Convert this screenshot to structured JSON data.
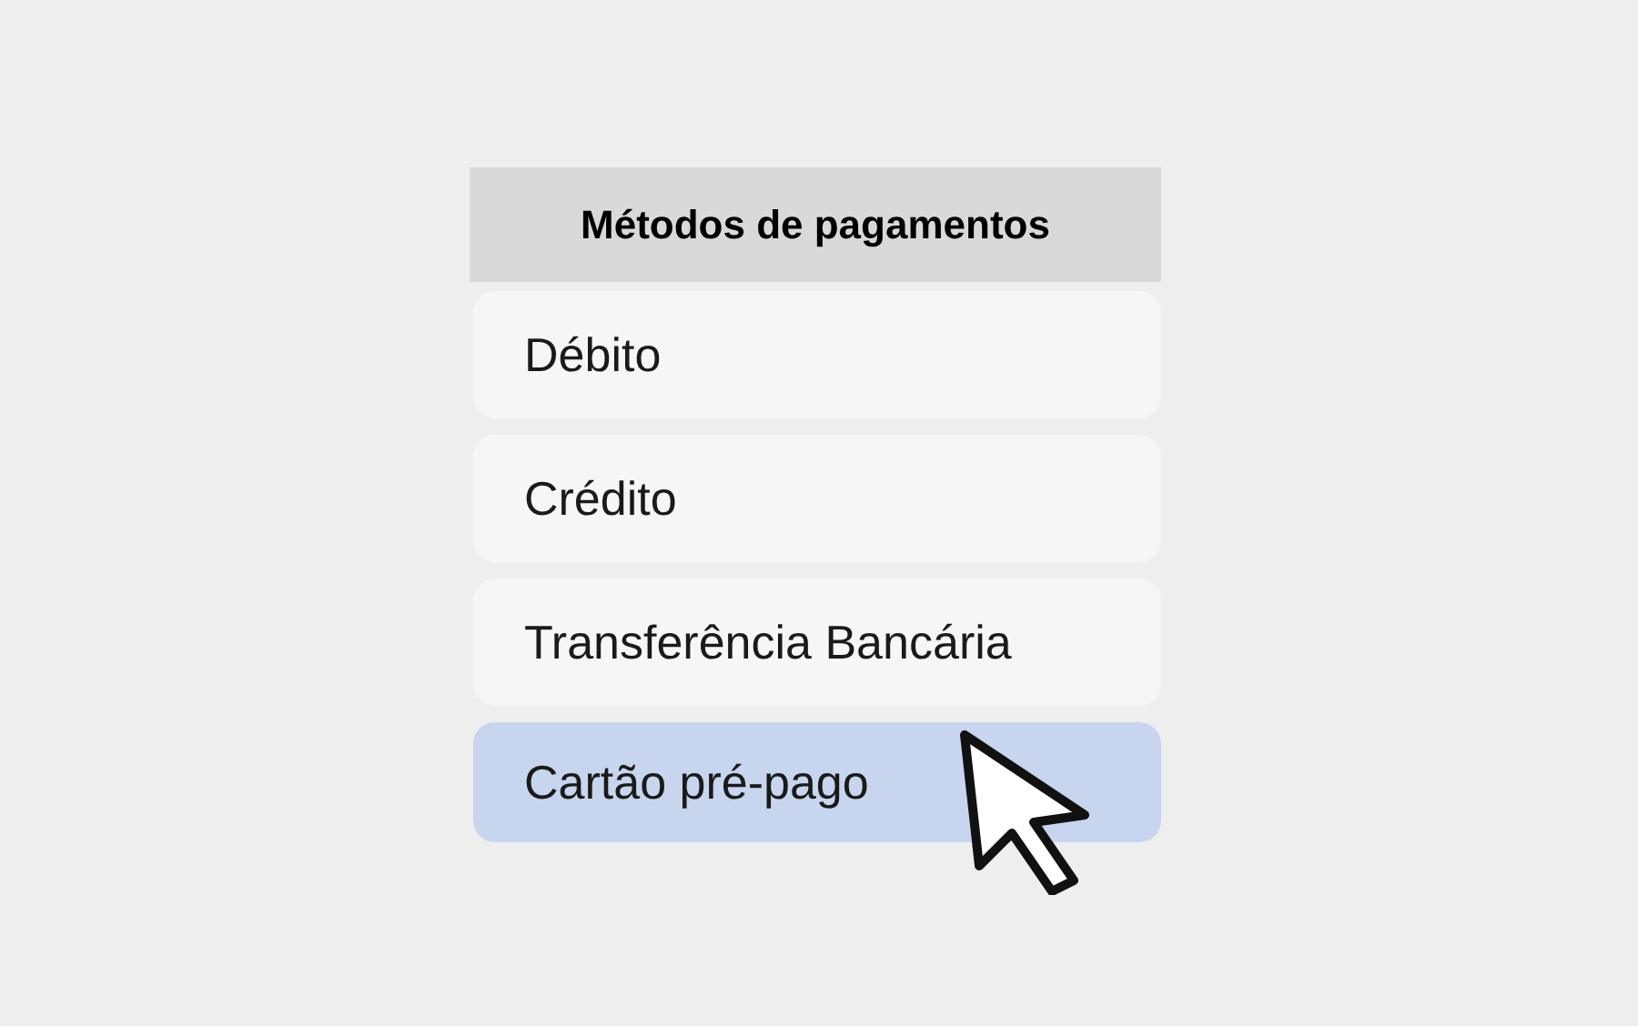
{
  "header": {
    "title": "Métodos de pagamentos"
  },
  "methods": [
    {
      "label": "Débito",
      "selected": false
    },
    {
      "label": "Crédito",
      "selected": false
    },
    {
      "label": "Transferência Bancária",
      "selected": false
    },
    {
      "label": "Cartão pré-pago",
      "selected": true
    }
  ]
}
